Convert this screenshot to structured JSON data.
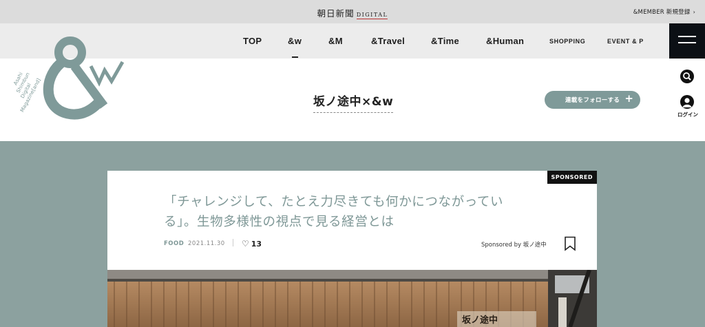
{
  "topbar": {
    "brand": "朝日新聞",
    "brand_sub": "DIGITAL",
    "member_link": "&MEMBER 新規登録",
    "member_chevron": "›"
  },
  "nav": {
    "items": [
      {
        "label": "TOP"
      },
      {
        "label": "&w"
      },
      {
        "label": "&M"
      },
      {
        "label": "&Travel"
      },
      {
        "label": "&Time"
      },
      {
        "label": "&Human"
      },
      {
        "label": "SHOPPING"
      },
      {
        "label": "EVENT & P"
      }
    ],
    "active_index": 1,
    "menu_icon": "hamburger-icon"
  },
  "logo": {
    "glyphs": "&w",
    "tagline": [
      "Asahi",
      "Shimbun",
      "Digital",
      "Magazine[and]"
    ]
  },
  "side": {
    "search_icon": "search-icon",
    "login_icon": "user-icon",
    "login_label": "ログイン"
  },
  "series": {
    "title": "坂ノ途中×&w",
    "follow_label": "連載をフォローする",
    "follow_plus": "+"
  },
  "article": {
    "badge": "SPONSORED",
    "title_line1": "「チャレンジして、たとえ力尽きても何かにつながってい",
    "title_line2": "る」。生物多様性の視点で見る経営とは",
    "category": "FOOD",
    "date": "2021.11.30",
    "likes": "13",
    "sponsor": "Sponsored by 坂ノ途中",
    "bookmark_icon": "bookmark-icon",
    "photo_sign": "坂ノ途中"
  },
  "colors": {
    "accent": "#7f9a99",
    "band": "#8ca19f",
    "title_text": "#7f9897",
    "topbar": "#dcdcdc",
    "navbar": "#ececec",
    "menu_button": "#0c1015"
  }
}
